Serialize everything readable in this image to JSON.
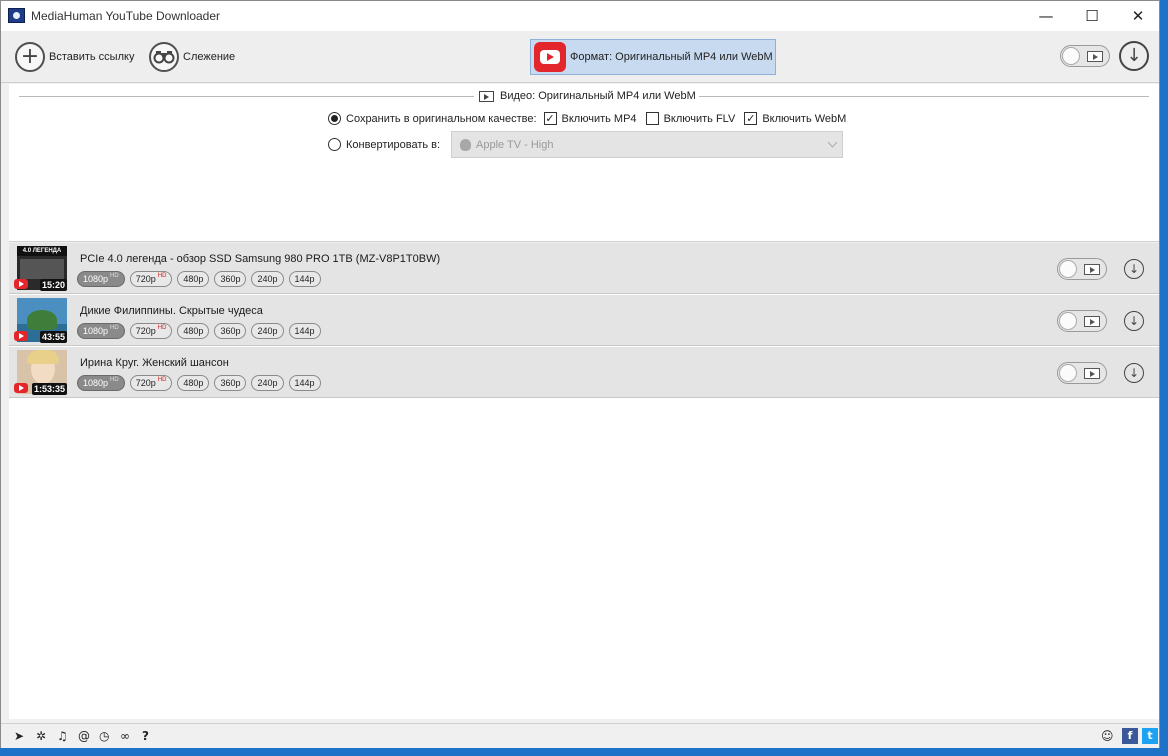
{
  "window": {
    "title": "MediaHuman YouTube Downloader",
    "controls": {
      "minimize": "—",
      "maximize": "☐",
      "close": "✕"
    }
  },
  "toolbar": {
    "paste_label": "Вставить ссылку",
    "tracking_label": "Слежение",
    "format_label": "Формат: Оригинальный MP4 или WebM"
  },
  "settings": {
    "section_title": "Видео: Оригинальный MP4 или WebM",
    "save_original_label": "Сохранить в оригинальном качестве:",
    "include_mp4_label": "Включить MP4",
    "include_flv_label": "Включить FLV",
    "include_webm_label": "Включить WebM",
    "convert_label": "Конвертировать в:",
    "convert_preset": "Apple TV - High",
    "save_original_selected": true,
    "include_mp4": true,
    "include_flv": false,
    "include_webm": true
  },
  "videos": [
    {
      "title": "PCIe 4.0 легенда - обзор SSD Samsung 980 PRO 1TB (MZ-V8P1T0BW)",
      "duration": "15:20",
      "thumb_caption": "4.0 ЛЕГЕНДА",
      "qualities": [
        {
          "label": "1080p",
          "tag": "HD"
        },
        {
          "label": "720p",
          "tag": "HD"
        },
        {
          "label": "480p",
          "tag": ""
        },
        {
          "label": "360p",
          "tag": ""
        },
        {
          "label": "240p",
          "tag": ""
        },
        {
          "label": "144p",
          "tag": ""
        }
      ]
    },
    {
      "title": "Дикие Филиппины. Скрытые чудеса",
      "duration": "43:55",
      "qualities": [
        {
          "label": "1080p",
          "tag": "HD"
        },
        {
          "label": "720p",
          "tag": "HD"
        },
        {
          "label": "480p",
          "tag": ""
        },
        {
          "label": "360p",
          "tag": ""
        },
        {
          "label": "240p",
          "tag": ""
        },
        {
          "label": "144p",
          "tag": ""
        }
      ]
    },
    {
      "title": "Ирина Круг. Женский шансон",
      "duration": "1:53:35",
      "qualities": [
        {
          "label": "1080p",
          "tag": "HD"
        },
        {
          "label": "720p",
          "tag": "HD"
        },
        {
          "label": "480p",
          "tag": ""
        },
        {
          "label": "360p",
          "tag": ""
        },
        {
          "label": "240p",
          "tag": ""
        },
        {
          "label": "144p",
          "tag": ""
        }
      ]
    }
  ],
  "statusbar": {
    "icons": [
      "send-icon",
      "gear-icon",
      "music-note-icon",
      "snail-icon",
      "clock-icon",
      "binoculars-icon",
      "help-icon"
    ],
    "help": "?",
    "social": {
      "facebook": "f",
      "twitter": "t"
    }
  },
  "colors": {
    "accent": "#c8daf0",
    "youtube_red": "#e3262b",
    "selected_quality": "#8a8a8a",
    "desktop": "#1e73c9"
  }
}
